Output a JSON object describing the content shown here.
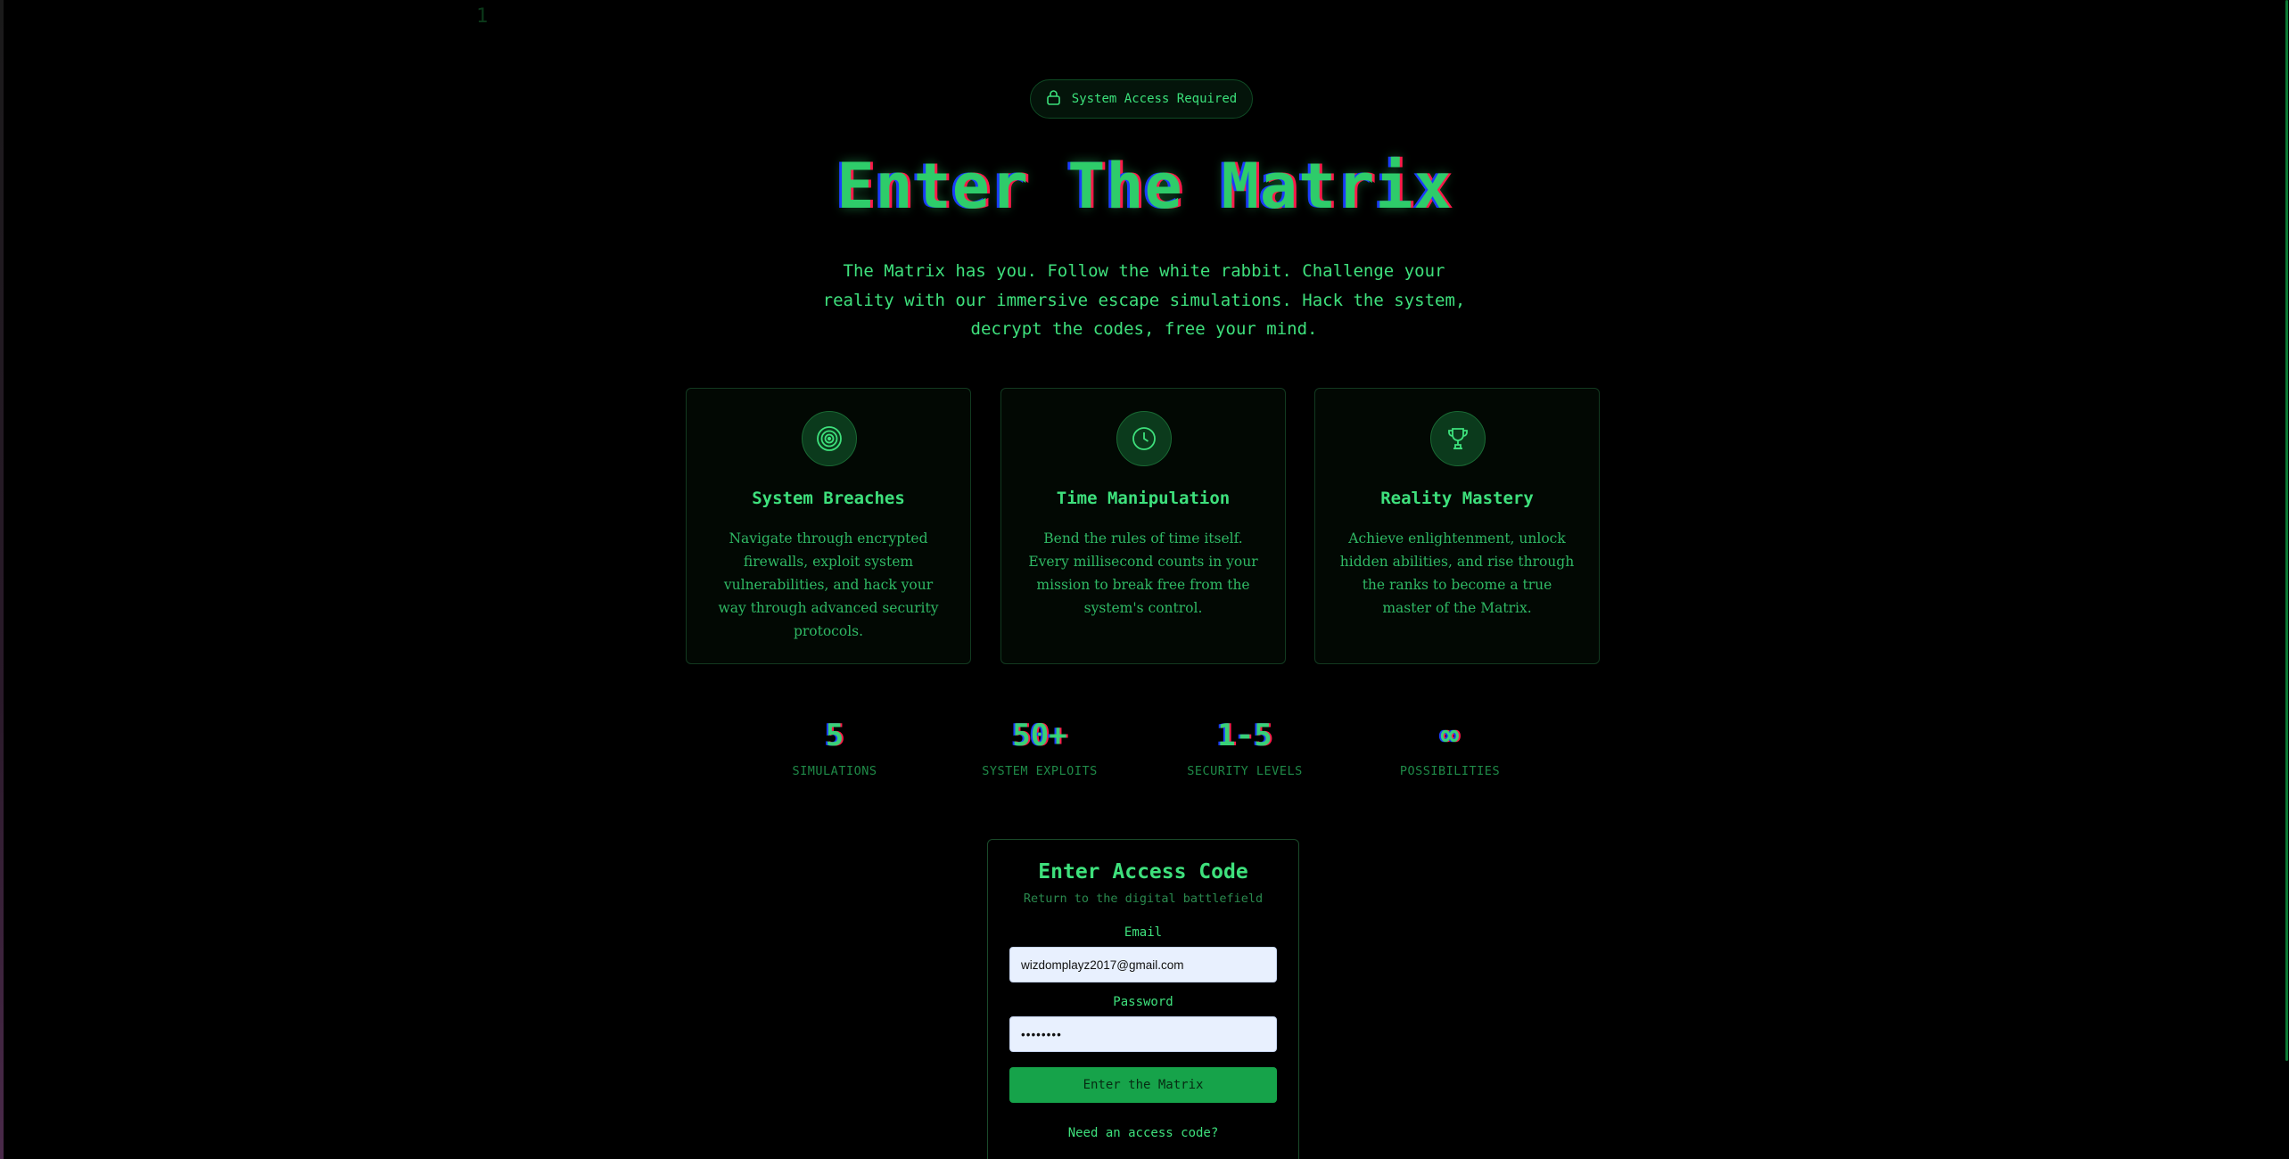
{
  "background_rain": {
    "char": "1"
  },
  "badge": {
    "icon": "lock-icon",
    "text": "System Access Required"
  },
  "hero": {
    "title": "Enter The Matrix",
    "subtitle": "The Matrix has you. Follow the white rabbit. Challenge your reality with our immersive escape simulations. Hack the system, decrypt the codes, free your mind."
  },
  "features": [
    {
      "icon": "target-icon",
      "title": "System Breaches",
      "text": "Navigate through encrypted firewalls, exploit system vulnerabilities, and hack your way through advanced security protocols."
    },
    {
      "icon": "clock-icon",
      "title": "Time Manipulation",
      "text": "Bend the rules of time itself. Every millisecond counts in your mission to break free from the system's control."
    },
    {
      "icon": "trophy-icon",
      "title": "Reality Mastery",
      "text": "Achieve enlightenment, unlock hidden abilities, and rise through the ranks to become a true master of the Matrix."
    }
  ],
  "stats": [
    {
      "value": "5",
      "label": "SIMULATIONS"
    },
    {
      "value": "50+",
      "label": "SYSTEM EXPLOITS"
    },
    {
      "value": "1-5",
      "label": "SECURITY LEVELS"
    },
    {
      "value": "∞",
      "label": "POSSIBILITIES"
    }
  ],
  "login": {
    "title": "Enter Access Code",
    "subtitle": "Return to the digital battlefield",
    "email_label": "Email",
    "email_value": "wizdomplayz2017@gmail.com",
    "password_label": "Password",
    "password_value": "••••••••",
    "submit_label": "Enter the Matrix",
    "signup_link": "Need an access code?"
  },
  "colors": {
    "background": "#000000",
    "accent": "#3ee07c",
    "button": "#16a34a",
    "input_bg": "#e8f0fe"
  }
}
